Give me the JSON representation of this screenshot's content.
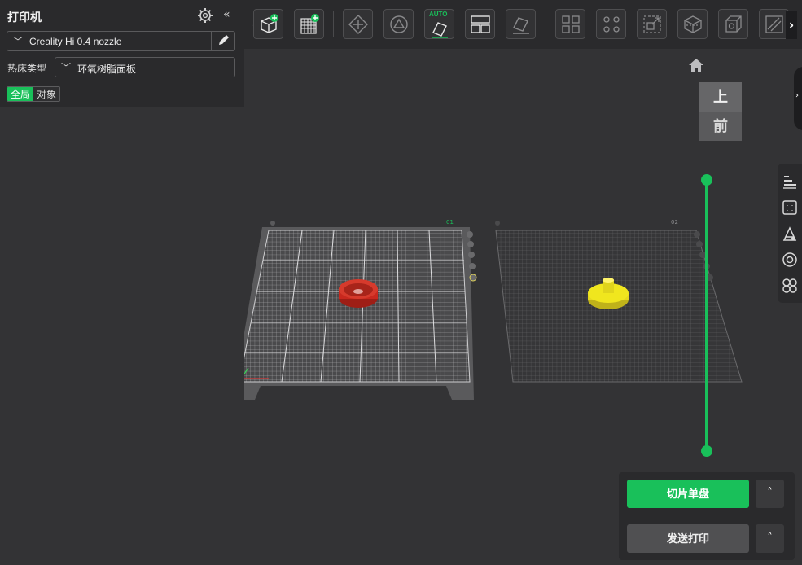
{
  "printer_panel": {
    "title": "打印机",
    "collapse_glyph": "«",
    "printer_name": "Creality Hi 0.4 nozzle",
    "bed_label": "热床类型",
    "bed_type": "环氧树脂面板",
    "scope_global": "全局",
    "scope_object": "对象",
    "dropdown_glyph": "﹀"
  },
  "toolbar": {
    "left_arrow": "‹",
    "right_arrow": "›",
    "auto_label": "AUTO",
    "buttons": [
      "add-object-icon",
      "add-plate-icon",
      "orient-icon",
      "rotate-icon",
      "auto-orient-icon",
      "arrange-icon",
      "lay-on-face-icon",
      "split-objects-icon",
      "split-parts-icon",
      "scale-icon",
      "cut-icon",
      "hollow-icon",
      "seam-icon"
    ]
  },
  "viewport": {
    "view_cube_top": "上",
    "view_cube_front": "前",
    "right_tab_glyph": "›",
    "plate_labels": [
      "01",
      "02"
    ]
  },
  "side_tools": [
    "layers-icon",
    "support-paint-icon",
    "seam-paint-icon",
    "color-paint-icon",
    "fuzzy-skin-icon"
  ],
  "actions": {
    "slice_label": "切片单盘",
    "send_label": "发送打印",
    "expand_glyph": "˄"
  },
  "colors": {
    "accent": "#19c05a",
    "panel_bg": "#2a2a2c",
    "viewport_bg": "#333335",
    "object_1": "#c8281e",
    "object_2": "#f0e61e"
  }
}
